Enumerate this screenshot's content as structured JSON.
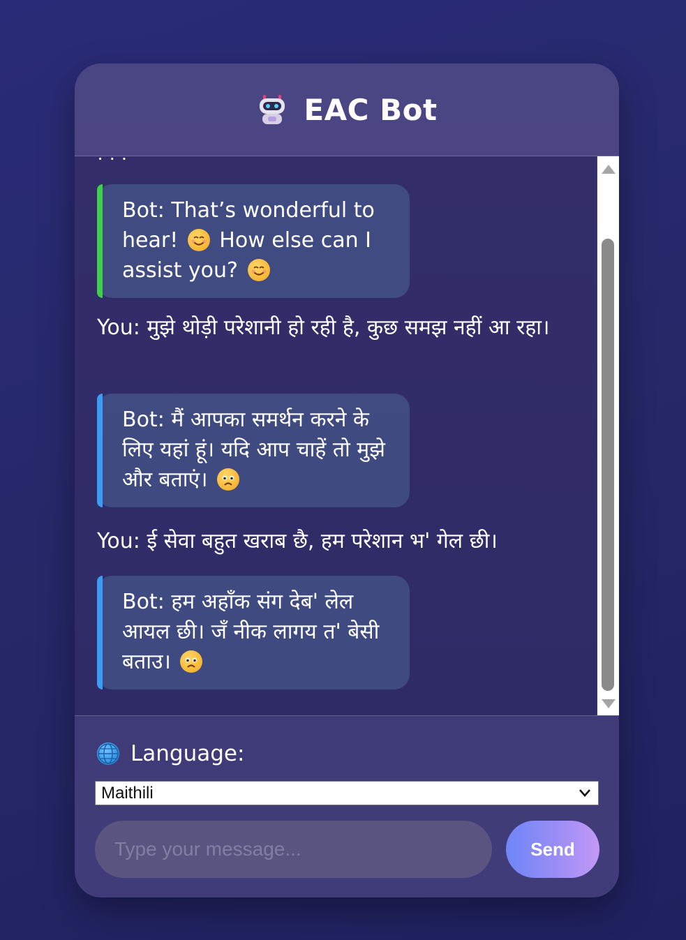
{
  "header": {
    "title": "EAC Bot",
    "icon": "robot-icon"
  },
  "messages": [
    {
      "type": "bot",
      "accent": "#3ed04a",
      "text": "Bot: That’s wonderful to hear! ",
      "text2": " How else can I assist you? ",
      "emoji": "smile"
    },
    {
      "type": "user",
      "text": "You: मुझे थोड़ी परेशानी हो रही है, कुछ समझ नहीं आ रहा।"
    },
    {
      "type": "bot",
      "accent": "#3a9cf2",
      "text": "Bot: मैं आपका समर्थन करने के लिए यहां हूं। यदि आप चाहें तो मुझे और बताएं। ",
      "emoji": "sad"
    },
    {
      "type": "user",
      "text": "You: ई सेवा बहुत खराब छै, हम परेशान भ' गेल छी।"
    },
    {
      "type": "bot",
      "accent": "#3a9cf2",
      "text": "Bot: हम अहाँक संग देब' लेल आयल छी। जँ नीक लागय त' बेसी बताउ। ",
      "emoji": "sad"
    }
  ],
  "language": {
    "label": "Language:",
    "selected": "Maithili",
    "icon": "globe-icon"
  },
  "composer": {
    "placeholder": "Type your message...",
    "send_label": "Send"
  },
  "colors": {
    "bot_accent_green": "#3ed04a",
    "bot_accent_blue": "#3a9cf2",
    "send_gradient_start": "#6e86f6",
    "send_gradient_end": "#c299f7"
  }
}
